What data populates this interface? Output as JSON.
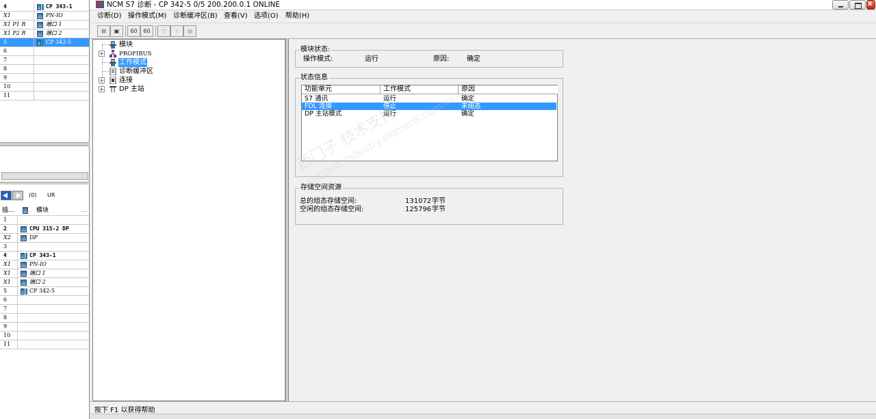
{
  "left_panel": {
    "upper_rows": [
      {
        "slot": "4",
        "module": "CP 343-1",
        "style": "bold",
        "icon": "dual"
      },
      {
        "slot": "X1",
        "module": "PN-IO",
        "style": "ital",
        "icon": "single"
      },
      {
        "slot": "X1 P1 R",
        "module": "端口 1",
        "style": "ital",
        "icon": "single"
      },
      {
        "slot": "X1 P2 R",
        "module": "端口 2",
        "style": "ital",
        "icon": "single"
      },
      {
        "slot": "5",
        "module": "CP 342-5",
        "style": "sel",
        "icon": "dual"
      },
      {
        "slot": "6",
        "module": "",
        "style": "",
        "icon": ""
      },
      {
        "slot": "7",
        "module": "",
        "style": "",
        "icon": ""
      },
      {
        "slot": "8",
        "module": "",
        "style": "",
        "icon": ""
      },
      {
        "slot": "9",
        "module": "",
        "style": "",
        "icon": ""
      },
      {
        "slot": "10",
        "module": "",
        "style": "",
        "icon": ""
      },
      {
        "slot": "11",
        "module": "",
        "style": "",
        "icon": ""
      }
    ],
    "rack_index": "(0)",
    "rack_name": "UR",
    "lower_header": {
      "slot": "插...",
      "module": "模块",
      "more": "..."
    },
    "lower_rows": [
      {
        "slot": "1",
        "module": "",
        "style": "",
        "icon": ""
      },
      {
        "slot": "2",
        "module": "CPU 315-2 DP",
        "style": "bold",
        "icon": "single"
      },
      {
        "slot": "X2",
        "module": "DP",
        "style": "ital",
        "icon": "single"
      },
      {
        "slot": "3",
        "module": "",
        "style": "",
        "icon": ""
      },
      {
        "slot": "4",
        "module": "CP 343-1",
        "style": "bold",
        "icon": "dual"
      },
      {
        "slot": "X1",
        "module": "PN-IO",
        "style": "ital",
        "icon": "single"
      },
      {
        "slot": "X1",
        "module": "端口 1",
        "style": "ital",
        "icon": "single"
      },
      {
        "slot": "X1",
        "module": "端口 2",
        "style": "ital",
        "icon": "single"
      },
      {
        "slot": "5",
        "module": "CP 342-5",
        "style": "",
        "icon": "dual"
      },
      {
        "slot": "6",
        "module": "",
        "style": "",
        "icon": ""
      },
      {
        "slot": "7",
        "module": "",
        "style": "",
        "icon": ""
      },
      {
        "slot": "8",
        "module": "",
        "style": "",
        "icon": ""
      },
      {
        "slot": "9",
        "module": "",
        "style": "",
        "icon": ""
      },
      {
        "slot": "10",
        "module": "",
        "style": "",
        "icon": ""
      },
      {
        "slot": "11",
        "module": "",
        "style": "",
        "icon": ""
      }
    ]
  },
  "window": {
    "title": "NCM S7 诊断 - CP 342-5 0/5 200.200.0.1  ONLINE",
    "close_glyph": "x"
  },
  "menu": [
    "诊断(D)",
    "操作模式(M)",
    "诊断缓冲区(B)",
    "查看(V)",
    "选项(O)",
    "帮助(H)"
  ],
  "toolbar": {
    "buttons": [
      {
        "name": "connect-button",
        "glyph": "⊟",
        "disabled": false
      },
      {
        "name": "print-button",
        "glyph": "▣",
        "disabled": false
      },
      {
        "name": "refresh-button",
        "glyph": "60",
        "disabled": false
      },
      {
        "name": "refresh-all-button",
        "glyph": "60",
        "disabled": false
      },
      {
        "name": "filter-button",
        "glyph": "▽",
        "disabled": true
      },
      {
        "name": "value-button",
        "glyph": "⁝⁝",
        "disabled": true
      },
      {
        "name": "info-button",
        "glyph": "▤",
        "disabled": true
      }
    ]
  },
  "tree": {
    "items": [
      {
        "label": "模块",
        "expander": "",
        "icon": "module"
      },
      {
        "label": "PROFIBUS",
        "expander": "+",
        "icon": "bus"
      },
      {
        "label": "工作模式",
        "expander": "",
        "icon": "module",
        "selected": true
      },
      {
        "label": "诊断缓冲区",
        "expander": "",
        "icon": "buffer"
      },
      {
        "label": "连接",
        "expander": "+",
        "icon": "conn"
      },
      {
        "label": "DP 主站",
        "expander": "+",
        "icon": "dp"
      }
    ]
  },
  "module_status": {
    "group_title": "模块状态:",
    "mode_label": "操作模式:",
    "mode_value": "运行",
    "reason_label": "原因:",
    "reason_value": "确定"
  },
  "status_info": {
    "group_title": "状态信息",
    "columns": [
      "功能单元",
      "工作模式",
      "原因"
    ],
    "rows": [
      {
        "unit": "S7 通讯",
        "mode": "运行",
        "reason": "确定",
        "selected": false
      },
      {
        "unit": "FDL 连接",
        "mode": "停止",
        "reason": "未组态",
        "selected": true
      },
      {
        "unit": "DP 主站模式",
        "mode": "运行",
        "reason": "确定",
        "selected": false
      }
    ]
  },
  "memory": {
    "group_title": "存储空间资源",
    "total_label": "总的组态存储空间:",
    "total_value": "131072",
    "total_unit": "字节",
    "free_label": "空闲的组态存储空间:",
    "free_value": "125796",
    "free_unit": "字节"
  },
  "watermark": {
    "line1": "西门子  技术支持",
    "line2": "support.industry.siemens.com/cs"
  },
  "status_bar": {
    "text": "按下 F1 以获得帮助"
  },
  "colors": {
    "selection": "#3399ff",
    "window_bg": "#f0f0f0"
  }
}
